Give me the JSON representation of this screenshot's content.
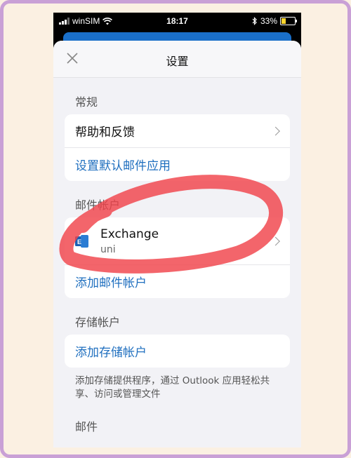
{
  "statusbar": {
    "carrier": "winSIM",
    "time": "18:17",
    "battery": "33%",
    "battery_level": 0.33
  },
  "nav": {
    "title": "设置"
  },
  "sections": {
    "general": {
      "label": "常规",
      "help": "帮助和反馈",
      "default_app": "设置默认邮件应用"
    },
    "mail_accounts": {
      "label": "邮件帐户",
      "account_name": "Exchange",
      "account_sub": "uni",
      "add": "添加邮件帐户"
    },
    "storage": {
      "label": "存储帐户",
      "add": "添加存储帐户",
      "description": "添加存储提供程序，通过 Outlook 应用轻松共享、访问或管理文件"
    },
    "mail": {
      "label": "邮件"
    }
  },
  "colors": {
    "link": "#1f6fbf",
    "annotation": "#f0434b",
    "frame": "#c9a0d6",
    "battery_fill": "#ffd52e"
  },
  "icons": {
    "close": "close-icon",
    "chevron": "chevron-right-icon",
    "account": "exchange-icon",
    "wifi": "wifi-icon",
    "bluetooth": "bluetooth-icon"
  }
}
